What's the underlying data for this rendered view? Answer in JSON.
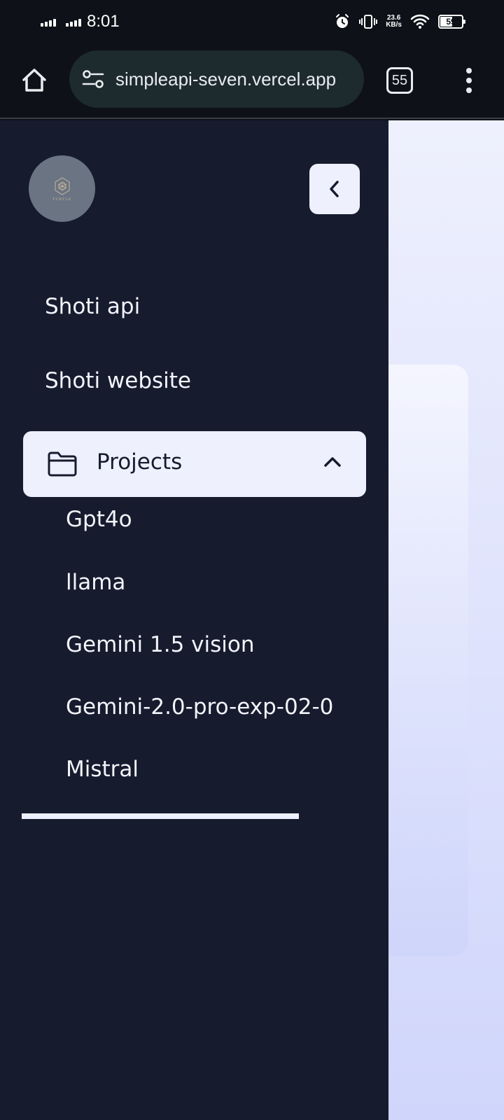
{
  "status_bar": {
    "time": "8:01",
    "speed_value": "23.6",
    "speed_unit": "KB/s",
    "battery": "59",
    "battery_level": 0.59
  },
  "browser": {
    "url": "simpleapi-seven.vercel.app",
    "tab_count": "55"
  },
  "sidebar": {
    "logo_text": "TURTLE",
    "nav_items": [
      {
        "label": "Shoti api"
      },
      {
        "label": "Shoti website"
      }
    ],
    "projects": {
      "label": "Projects",
      "expanded": true,
      "items": [
        {
          "label": "Gpt4o"
        },
        {
          "label": "llama"
        },
        {
          "label": "Gemini 1.5 vision"
        },
        {
          "label": "Gemini-2.0-pro-exp-02-0"
        },
        {
          "label": "Mistral"
        }
      ]
    }
  },
  "colors": {
    "sidebar_bg": "#161b2e",
    "active_bg": "#eef0fd",
    "browser_bg": "#0e1117",
    "url_pill_bg": "#1d2a2e"
  }
}
